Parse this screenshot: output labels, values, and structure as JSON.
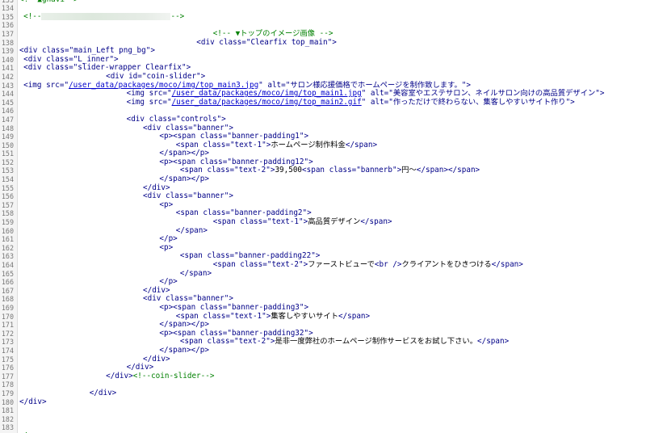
{
  "colors": {
    "tag": "#000088",
    "text": "#000000",
    "comment": "#008000",
    "link": "#0000cc",
    "line_number": "#777777"
  },
  "lines": [
    {
      "n": "133",
      "indent": 0,
      "parts": [
        {
          "t": "<!--▲gnavi-->",
          "c": "com"
        }
      ]
    },
    {
      "n": "134",
      "indent": 0,
      "parts": []
    },
    {
      "n": "135",
      "indent": 1,
      "parts": [
        {
          "t": "<!--",
          "c": "com"
        },
        {
          "t": "",
          "c": "blur"
        },
        {
          "t": "-->",
          "c": "com"
        }
      ]
    },
    {
      "n": "136",
      "indent": 0,
      "parts": []
    },
    {
      "n": "137",
      "indent": 47,
      "parts": [
        {
          "t": "<!-- ▼トップのイメージ画像 -->",
          "c": "com"
        }
      ]
    },
    {
      "n": "138",
      "indent": 43,
      "parts": [
        {
          "t": "<div class=\"Clearfix top_main\">",
          "c": "tag"
        }
      ]
    },
    {
      "n": "139",
      "indent": 0,
      "parts": [
        {
          "t": "<div class=\"main_Left png_bg\">",
          "c": "tag"
        }
      ]
    },
    {
      "n": "140",
      "indent": 1,
      "parts": [
        {
          "t": "<div class=\"L_inner\">",
          "c": "tag"
        }
      ]
    },
    {
      "n": "141",
      "indent": 1,
      "parts": [
        {
          "t": "<div class=\"slider-wrapper Clearfix\">",
          "c": "tag"
        }
      ]
    },
    {
      "n": "142",
      "indent": 21,
      "parts": [
        {
          "t": "<div id=\"coin-slider\">",
          "c": "tag"
        }
      ]
    },
    {
      "n": "143",
      "indent": 1,
      "parts": [
        {
          "t": "<img src=\"",
          "c": "tag"
        },
        {
          "t": "/user_data/packages/moco/img/top_main3.jpg",
          "c": "lnk"
        },
        {
          "t": "\" alt=\"サロン様応援価格でホームページを制作致します。\">",
          "c": "tag"
        }
      ]
    },
    {
      "n": "144",
      "indent": 26,
      "parts": [
        {
          "t": "<img src=\"",
          "c": "tag"
        },
        {
          "t": "/user_data/packages/moco/img/top_main1.jpg",
          "c": "lnk"
        },
        {
          "t": "\" alt=\"美容室やエステサロン、ネイルサロン向けの高品質デザイン\">",
          "c": "tag"
        }
      ]
    },
    {
      "n": "145",
      "indent": 26,
      "parts": [
        {
          "t": "<img src=\"",
          "c": "tag"
        },
        {
          "t": "/user_data/packages/moco/img/top_main2.gif",
          "c": "lnk"
        },
        {
          "t": "\" alt=\"作っただけで終わらない、集客しやすいサイト作り\">",
          "c": "tag"
        }
      ]
    },
    {
      "n": "146",
      "indent": 0,
      "parts": []
    },
    {
      "n": "147",
      "indent": 26,
      "parts": [
        {
          "t": "<div class=\"controls\">",
          "c": "tag"
        }
      ]
    },
    {
      "n": "148",
      "indent": 30,
      "parts": [
        {
          "t": "<div class=\"banner\">",
          "c": "tag"
        }
      ]
    },
    {
      "n": "149",
      "indent": 34,
      "parts": [
        {
          "t": "<p><span class=\"banner-padding1\">",
          "c": "tag"
        }
      ]
    },
    {
      "n": "150",
      "indent": 38,
      "parts": [
        {
          "t": "<span class=\"text-1\">",
          "c": "tag"
        },
        {
          "t": "ホームページ制作料金",
          "c": "txt"
        },
        {
          "t": "</span>",
          "c": "tag"
        }
      ]
    },
    {
      "n": "151",
      "indent": 34,
      "parts": [
        {
          "t": "</span></p>",
          "c": "tag"
        }
      ]
    },
    {
      "n": "152",
      "indent": 34,
      "parts": [
        {
          "t": "<p><span class=\"banner-padding12\">",
          "c": "tag"
        }
      ]
    },
    {
      "n": "153",
      "indent": 39,
      "parts": [
        {
          "t": "<span class=\"text-2\">",
          "c": "tag"
        },
        {
          "t": "39,500",
          "c": "txt"
        },
        {
          "t": "<span class=\"bannerb\">",
          "c": "tag"
        },
        {
          "t": "円～",
          "c": "txt"
        },
        {
          "t": "</span></span>",
          "c": "tag"
        }
      ]
    },
    {
      "n": "154",
      "indent": 34,
      "parts": [
        {
          "t": "</span></p>",
          "c": "tag"
        }
      ]
    },
    {
      "n": "155",
      "indent": 30,
      "parts": [
        {
          "t": "</div>",
          "c": "tag"
        }
      ]
    },
    {
      "n": "156",
      "indent": 30,
      "parts": [
        {
          "t": "<div class=\"banner\">",
          "c": "tag"
        }
      ]
    },
    {
      "n": "157",
      "indent": 34,
      "parts": [
        {
          "t": "<p>",
          "c": "tag"
        }
      ]
    },
    {
      "n": "158",
      "indent": 38,
      "parts": [
        {
          "t": "<span class=\"banner-padding2\">",
          "c": "tag"
        }
      ]
    },
    {
      "n": "159",
      "indent": 47,
      "parts": [
        {
          "t": "<span class=\"text-1\">",
          "c": "tag"
        },
        {
          "t": "高品質デザイン",
          "c": "txt"
        },
        {
          "t": "</span>",
          "c": "tag"
        }
      ]
    },
    {
      "n": "160",
      "indent": 38,
      "parts": [
        {
          "t": "</span>",
          "c": "tag"
        }
      ]
    },
    {
      "n": "161",
      "indent": 34,
      "parts": [
        {
          "t": "</p>",
          "c": "tag"
        }
      ]
    },
    {
      "n": "162",
      "indent": 34,
      "parts": [
        {
          "t": "<p>",
          "c": "tag"
        }
      ]
    },
    {
      "n": "163",
      "indent": 39,
      "parts": [
        {
          "t": "<span class=\"banner-padding22\">",
          "c": "tag"
        }
      ]
    },
    {
      "n": "164",
      "indent": 47,
      "parts": [
        {
          "t": "<span class=\"text-2\">",
          "c": "tag"
        },
        {
          "t": "ファーストビューで",
          "c": "txt"
        },
        {
          "t": "<br />",
          "c": "tag"
        },
        {
          "t": "クライアントをひきつける",
          "c": "txt"
        },
        {
          "t": "</span>",
          "c": "tag"
        }
      ]
    },
    {
      "n": "165",
      "indent": 39,
      "parts": [
        {
          "t": "</span>",
          "c": "tag"
        }
      ]
    },
    {
      "n": "166",
      "indent": 34,
      "parts": [
        {
          "t": "</p>",
          "c": "tag"
        }
      ]
    },
    {
      "n": "167",
      "indent": 30,
      "parts": [
        {
          "t": "</div>",
          "c": "tag"
        }
      ]
    },
    {
      "n": "168",
      "indent": 30,
      "parts": [
        {
          "t": "<div class=\"banner\">",
          "c": "tag"
        }
      ]
    },
    {
      "n": "169",
      "indent": 34,
      "parts": [
        {
          "t": "<p><span class=\"banner-padding3\">",
          "c": "tag"
        }
      ]
    },
    {
      "n": "170",
      "indent": 38,
      "parts": [
        {
          "t": "<span class=\"text-1\">",
          "c": "tag"
        },
        {
          "t": "集客しやすいサイト",
          "c": "txt"
        },
        {
          "t": "</span>",
          "c": "tag"
        }
      ]
    },
    {
      "n": "171",
      "indent": 34,
      "parts": [
        {
          "t": "</span></p>",
          "c": "tag"
        }
      ]
    },
    {
      "n": "172",
      "indent": 34,
      "parts": [
        {
          "t": "<p><span class=\"banner-padding32\">",
          "c": "tag"
        }
      ]
    },
    {
      "n": "173",
      "indent": 39,
      "parts": [
        {
          "t": "<span class=\"text-2\">",
          "c": "tag"
        },
        {
          "t": "是非一度弊社のホームページ制作サービスをお試し下さい。",
          "c": "txt"
        },
        {
          "t": "</span>",
          "c": "tag"
        }
      ]
    },
    {
      "n": "174",
      "indent": 34,
      "parts": [
        {
          "t": "</span></p>",
          "c": "tag"
        }
      ]
    },
    {
      "n": "175",
      "indent": 30,
      "parts": [
        {
          "t": "</div>",
          "c": "tag"
        }
      ]
    },
    {
      "n": "176",
      "indent": 26,
      "parts": [
        {
          "t": "</div>",
          "c": "tag"
        }
      ]
    },
    {
      "n": "177",
      "indent": 21,
      "parts": [
        {
          "t": "</div>",
          "c": "tag"
        },
        {
          "t": "<!--coin-slider-->",
          "c": "com"
        }
      ]
    },
    {
      "n": "178",
      "indent": 0,
      "parts": []
    },
    {
      "n": "179",
      "indent": 17,
      "parts": [
        {
          "t": "</div>",
          "c": "tag"
        }
      ]
    },
    {
      "n": "180",
      "indent": 0,
      "parts": [
        {
          "t": "</div>",
          "c": "tag"
        }
      ]
    },
    {
      "n": "181",
      "indent": 0,
      "parts": []
    },
    {
      "n": "182",
      "indent": 0,
      "parts": []
    },
    {
      "n": "183",
      "indent": 0,
      "parts": []
    },
    {
      "n": "184",
      "indent": 0,
      "parts": [
        {
          "t": "<!--",
          "c": "com"
        }
      ]
    }
  ]
}
